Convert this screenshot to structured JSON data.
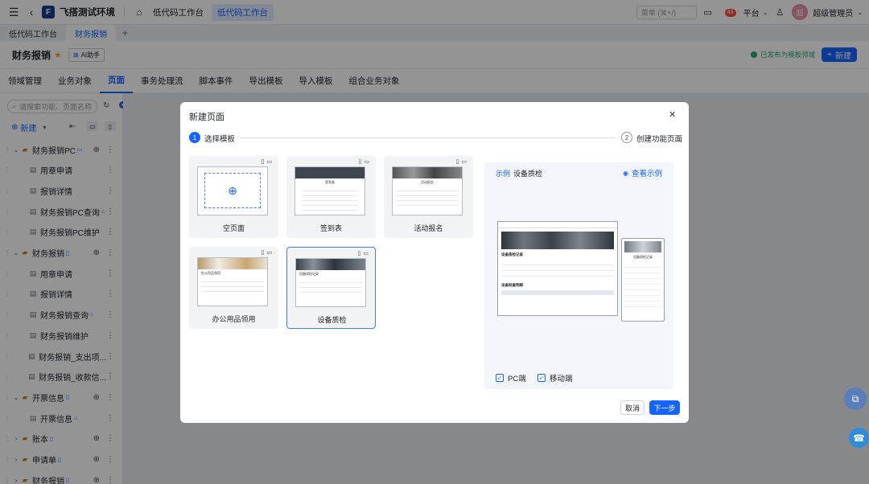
{
  "topbar": {
    "brand": "飞搭测试环境",
    "breadcrumb": [
      "低代码工作台",
      "低代码工作台"
    ],
    "search_placeholder": "菜单 (⌘+/)",
    "notification_count": "43",
    "platform_label": "平台",
    "avatar_text": "超",
    "user_name": "超级管理员"
  },
  "tabs": [
    "低代码工作台",
    "财务报销"
  ],
  "titlebar": {
    "title": "财务报销",
    "ai_button": "AI助手",
    "published_status": "已发布为模板领域",
    "new_button": "新建"
  },
  "nav": [
    "领域管理",
    "业务对象",
    "页面",
    "事务处理流",
    "脚本事件",
    "导出模板",
    "导入模板",
    "组合业务对象"
  ],
  "sidebar": {
    "search_placeholder": "请搜索功能、页面名称",
    "new_label": "新建",
    "items": [
      {
        "label": "财务报销PC",
        "level": 0
      },
      {
        "label": "用章申请",
        "level": 1
      },
      {
        "label": "报销详情",
        "level": 1
      },
      {
        "label": "财务报销PC查询",
        "level": 1
      },
      {
        "label": "财务报销PC维护",
        "level": 1
      },
      {
        "label": "财务报销",
        "level": 0
      },
      {
        "label": "用章申请",
        "level": 1
      },
      {
        "label": "报销详情",
        "level": 1
      },
      {
        "label": "财务报销查询",
        "level": 1
      },
      {
        "label": "财务报销维护",
        "level": 1
      },
      {
        "label": "财务报销_支出项...",
        "level": 1
      },
      {
        "label": "财务报销_收款信...",
        "level": 1
      },
      {
        "label": "开票信息",
        "level": 0
      },
      {
        "label": "开票信息",
        "level": 1
      },
      {
        "label": "账本",
        "level": 0
      },
      {
        "label": "申请单",
        "level": 0
      },
      {
        "label": "财务报销",
        "level": 0
      }
    ]
  },
  "modal": {
    "title": "新建页面",
    "steps": [
      {
        "num": "1",
        "label": "选择模板"
      },
      {
        "num": "2",
        "label": "创建功能页面"
      }
    ],
    "templates": [
      {
        "label": "空页面",
        "thumb_title": ""
      },
      {
        "label": "签到表",
        "thumb_title": "签到表"
      },
      {
        "label": "活动报名",
        "thumb_title": "活动报名"
      },
      {
        "label": "办公用品领用",
        "thumb_title": "办公用品领用"
      },
      {
        "label": "设备质检",
        "thumb_title": "设备质检记录"
      }
    ],
    "preview": {
      "tag": "示例",
      "name": "设备质检",
      "view_example": "查看示例",
      "section1": "设备质检记录",
      "section2": "设备检查明细",
      "mobile_title": "设备质检记录",
      "pc_checkbox": "PC端",
      "mobile_checkbox": "移动端"
    },
    "cancel_button": "取消",
    "next_button": "下一步"
  },
  "colors": {
    "primary": "#1664ff",
    "success": "#2ba471",
    "badge": "#f54a45"
  }
}
